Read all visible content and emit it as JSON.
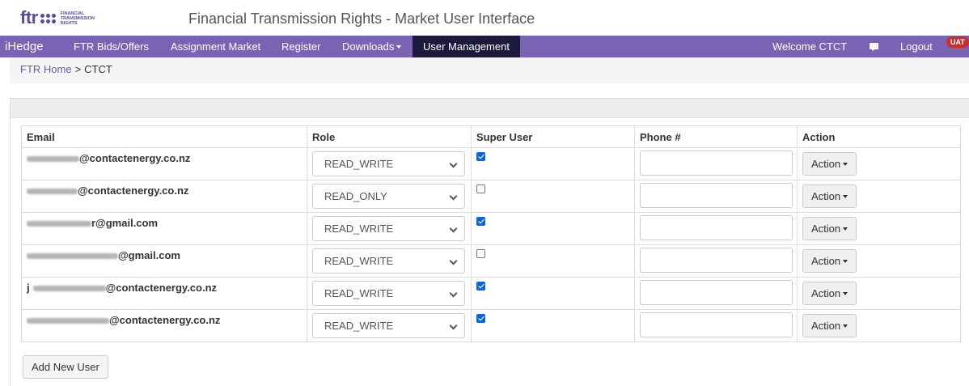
{
  "header": {
    "logo_text": "ftr",
    "logo_subtext": "FINANCIAL TRANSMISSION RIGHTS",
    "title": "Financial Transmission Rights - Market User Interface"
  },
  "nav": {
    "brand": "iHedge",
    "items": [
      {
        "label": "FTR Bids/Offers"
      },
      {
        "label": "Assignment Market"
      },
      {
        "label": "Register"
      },
      {
        "label": "Downloads"
      },
      {
        "label": "User Management",
        "active": true
      }
    ],
    "welcome": "Welcome CTCT",
    "logout": "Logout",
    "env_badge": "UAT",
    "colors": {
      "bar": "#7b63b4",
      "active": "#1c1a3d"
    }
  },
  "breadcrumb": {
    "home": "FTR Home",
    "separator": ">",
    "current": "CTCT"
  },
  "table": {
    "headers": [
      "Email",
      "Role",
      "Super User",
      "Phone #",
      "Action"
    ],
    "rows": [
      {
        "email_prefix": "",
        "email_suffix": "@contactenergy.co.nz",
        "role": "READ_WRITE",
        "super_user": true,
        "phone": "",
        "action": "Action"
      },
      {
        "email_prefix": "",
        "email_suffix": "@contactenergy.co.nz",
        "role": "READ_ONLY",
        "super_user": false,
        "phone": "",
        "action": "Action"
      },
      {
        "email_prefix": "",
        "email_suffix": "r@gmail.com",
        "role": "READ_WRITE",
        "super_user": true,
        "phone": "",
        "action": "Action"
      },
      {
        "email_prefix": "",
        "email_suffix": "@gmail.com",
        "role": "READ_WRITE",
        "super_user": false,
        "phone": "",
        "action": "Action"
      },
      {
        "email_prefix": "j",
        "email_suffix": "@contactenergy.co.nz",
        "role": "READ_WRITE",
        "super_user": true,
        "phone": "",
        "action": "Action"
      },
      {
        "email_prefix": "",
        "email_suffix": "@contactenergy.co.nz",
        "role": "READ_WRITE",
        "super_user": true,
        "phone": "",
        "action": "Action"
      }
    ]
  },
  "add_user_label": "Add New User"
}
